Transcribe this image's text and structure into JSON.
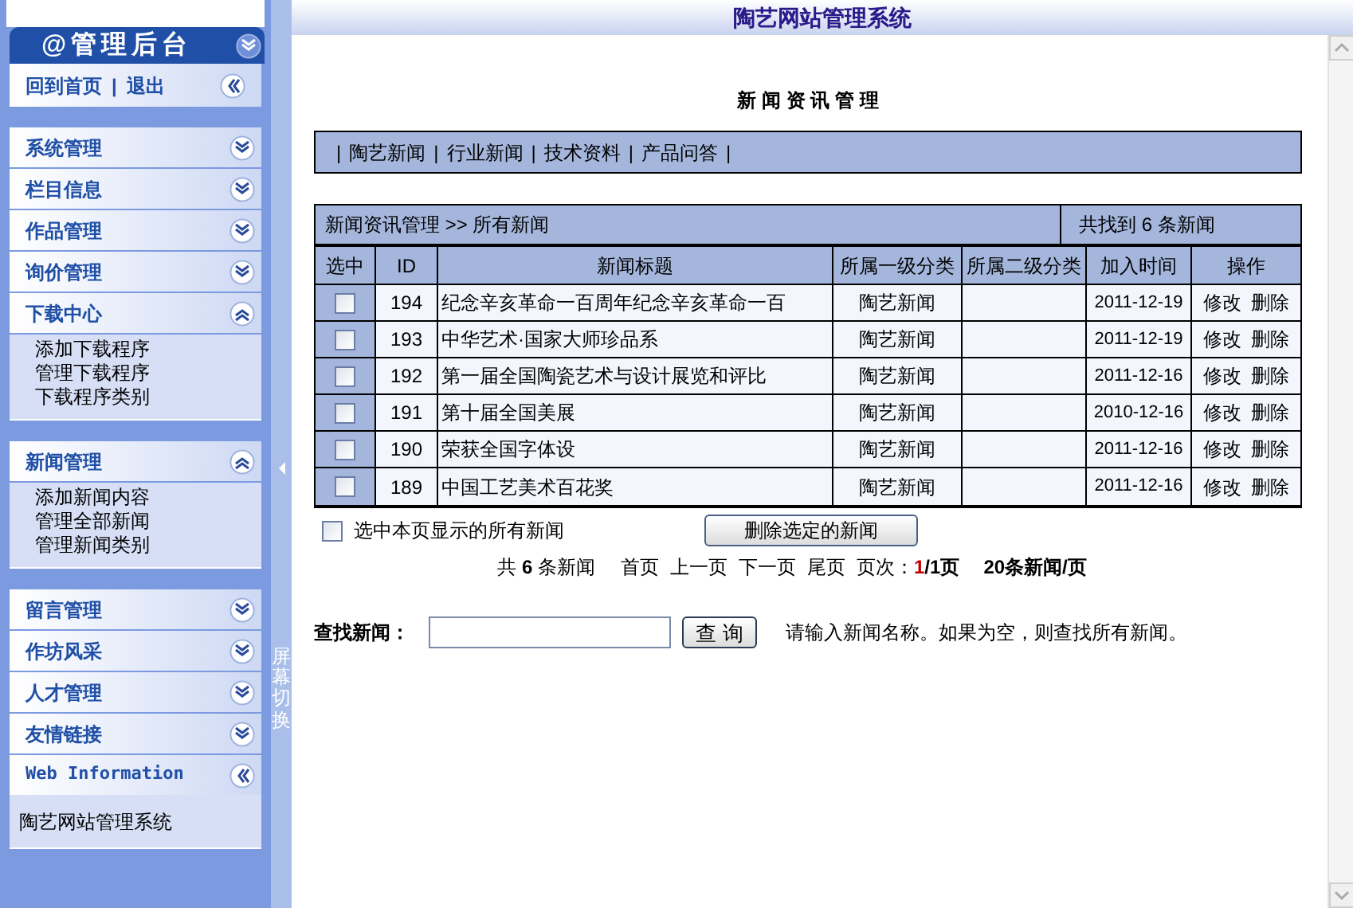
{
  "window": {
    "title": "陶艺网站管理系统"
  },
  "sidebar": {
    "header": {
      "title": "@管理后台",
      "expanded": false
    },
    "top_links": {
      "separator": "|",
      "links": [
        "回到首页",
        "退出"
      ]
    },
    "menu_groups": [
      {
        "items": [
          {
            "label": "系统管理",
            "expanded": false
          },
          {
            "label": "栏目信息",
            "expanded": false
          },
          {
            "label": "作品管理",
            "expanded": false
          },
          {
            "label": "询价管理",
            "expanded": false
          },
          {
            "label": "下载中心",
            "expanded": true,
            "children": [
              "添加下载程序",
              "管理下载程序",
              "下载程序类别"
            ]
          }
        ]
      },
      {
        "items": [
          {
            "label": "新闻管理",
            "expanded": true,
            "children": [
              "添加新闻内容",
              "管理全部新闻",
              "管理新闻类别"
            ]
          }
        ]
      },
      {
        "items": [
          {
            "label": "留言管理",
            "expanded": false
          },
          {
            "label": "作坊风采",
            "expanded": false
          },
          {
            "label": "人才管理",
            "expanded": false
          },
          {
            "label": "友情链接",
            "expanded": false
          }
        ]
      }
    ],
    "info": {
      "title": "Web Information",
      "text": "陶艺网站管理系统"
    }
  },
  "splitter": {
    "label": "屏幕切换"
  },
  "main": {
    "heading": "新 闻 资 讯 管 理",
    "category_bar": {
      "separator": "|",
      "links": [
        "陶艺新闻",
        "行业新闻",
        "技术资料",
        "产品问答"
      ]
    },
    "table": {
      "breadcrumb": "新闻资讯管理 >> 所有新闻",
      "found": "共找到 6 条新闻",
      "columns": [
        "选中",
        "ID",
        "新闻标题",
        "所属一级分类",
        "所属二级分类",
        "加入时间",
        "操作"
      ],
      "rows": [
        {
          "selected": false,
          "id": "194",
          "title": "纪念辛亥革命一百周年纪念辛亥革命一百",
          "category_1": "陶艺新闻",
          "date": "2011-12-19",
          "actions": [
            "修改",
            "删除"
          ]
        },
        {
          "selected": false,
          "id": "193",
          "title": "中华艺术·国家大师珍品系",
          "category_1": "陶艺新闻",
          "date": "2011-12-19",
          "actions": [
            "修改",
            "删除"
          ]
        },
        {
          "selected": false,
          "id": "192",
          "title": "第一届全国陶瓷艺术与设计展览和评比",
          "category_1": "陶艺新闻",
          "date": "2011-12-16",
          "actions": [
            "修改",
            "删除"
          ]
        },
        {
          "selected": false,
          "id": "191",
          "title": "第十届全国美展",
          "category_1": "陶艺新闻",
          "date": "2010-12-16",
          "actions": [
            "修改",
            "删除"
          ]
        },
        {
          "selected": false,
          "id": "190",
          "title": "荣获全国字体设",
          "category_1": "陶艺新闻",
          "date": "2011-12-16",
          "actions": [
            "修改",
            "删除"
          ]
        },
        {
          "selected": false,
          "id": "189",
          "title": "中国工艺美术百花奖",
          "category_1": "陶艺新闻",
          "date": "2011-12-16",
          "actions": [
            "修改",
            "删除"
          ]
        }
      ]
    },
    "select_all": {
      "label": "选中本页显示的所有新闻",
      "checked": false
    },
    "delete_button": "删除选定的新闻",
    "pagination": {
      "total": "共 **6** 条新闻",
      "links": [
        "首页",
        "上一页",
        "下一页",
        "尾页"
      ],
      "page_label": "页次：",
      "current": "1",
      "pages": "/1页",
      "per_page": "20条新闻/页"
    },
    "search": {
      "label": "查找新闻：",
      "button": "查 询",
      "hint": "请输入新闻名称。如果为空，则查找所有新闻。"
    }
  }
}
